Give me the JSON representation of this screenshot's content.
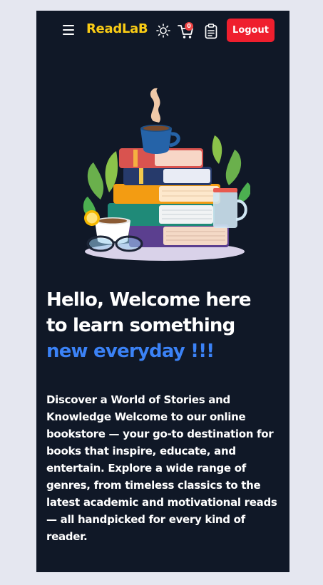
{
  "navbar": {
    "brand": "ReadLaB",
    "cart_count": "0",
    "logout_label": "Logout",
    "icons": [
      "menu-icon",
      "sun-icon",
      "cart-icon",
      "clipboard-icon"
    ]
  },
  "hero": {
    "heading_line1": "Hello, Welcome here",
    "heading_line2": "to learn something",
    "heading_accent": "new everyday !!!",
    "description": "Discover a World of Stories and Knowledge Welcome to our online bookstore — your go-to destination for books that inspire, educate, and entertain. Explore a wide range of genres, from timeless classics to the latest academic and motivational reads — all handpicked for every kind of reader."
  },
  "colors": {
    "background": "#101827",
    "page": "#e5e7f0",
    "brand": "#facc15",
    "accent": "#3b82f6",
    "logout": "#ef1f2e"
  }
}
